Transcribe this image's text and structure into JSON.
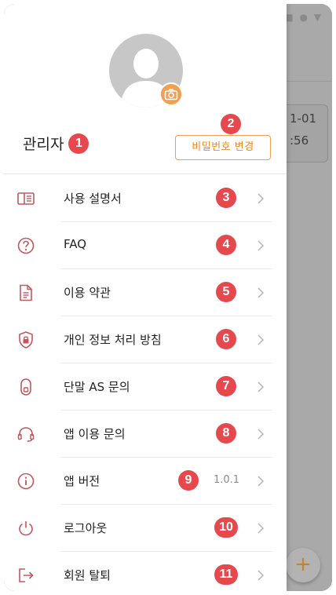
{
  "background": {
    "status_icons": "■ ● ▼",
    "card_line1": "1-01",
    "card_line2": ":56",
    "fab_label": "+"
  },
  "drawer": {
    "avatar": "avatar-placeholder",
    "camera_icon": "camera-icon",
    "admin_name": "관리자",
    "admin_marker": "1",
    "password_marker": "2",
    "change_password_label": "비밀번호 변경",
    "accent_color": "#f0a050",
    "marker_color": "#e5484d",
    "menu": [
      {
        "id": "manual",
        "label": "사용 설명서",
        "icon": "book-icon",
        "marker": "3"
      },
      {
        "id": "faq",
        "label": "FAQ",
        "icon": "question-icon",
        "marker": "4"
      },
      {
        "id": "terms",
        "label": "이용 약관",
        "icon": "document-icon",
        "marker": "5"
      },
      {
        "id": "privacy",
        "label": "개인 정보 처리 방침",
        "icon": "shield-lock-icon",
        "marker": "6"
      },
      {
        "id": "device-as",
        "label": "단말 AS 문의",
        "icon": "device-icon",
        "marker": "7"
      },
      {
        "id": "app-inquiry",
        "label": "앱 이용 문의",
        "icon": "headset-icon",
        "marker": "8"
      },
      {
        "id": "app-version",
        "label": "앱 버전",
        "icon": "info-icon",
        "marker": "9",
        "version": "1.0.1"
      },
      {
        "id": "logout",
        "label": "로그아웃",
        "icon": "power-icon",
        "marker": "10"
      },
      {
        "id": "withdraw",
        "label": "회원 탈퇴",
        "icon": "exit-icon",
        "marker": "11"
      }
    ]
  }
}
